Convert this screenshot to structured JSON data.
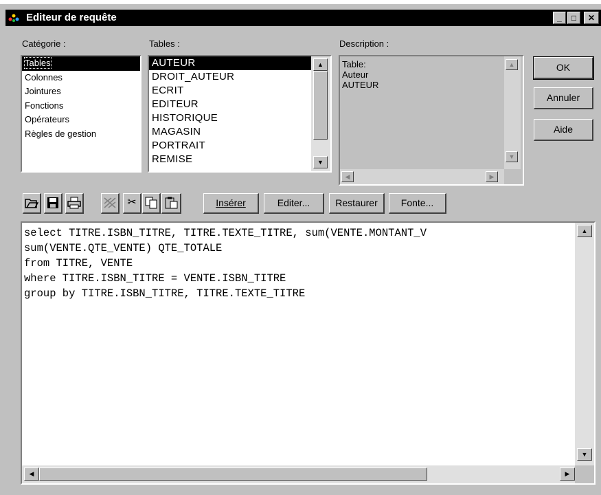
{
  "window": {
    "title": "Editeur de requête"
  },
  "labels": {
    "categorie": "Catégorie :",
    "tables": "Tables :",
    "description": "Description :"
  },
  "categories": [
    "Tables",
    "Colonnes",
    "Jointures",
    "Fonctions",
    "Opérateurs",
    "Règles de gestion"
  ],
  "tables": [
    "AUTEUR",
    "DROIT_AUTEUR",
    "ECRIT",
    "EDITEUR",
    "HISTORIQUE",
    "MAGASIN",
    "PORTRAIT",
    "REMISE"
  ],
  "description_lines": [
    "Table:",
    "Auteur",
    "AUTEUR"
  ],
  "buttons": {
    "ok": "OK",
    "annuler": "Annuler",
    "aide": "Aide"
  },
  "toolbar": {
    "inserer": "Insérer",
    "editer": "Editer...",
    "restaurer": "Restaurer",
    "fonte": "Fonte...",
    "icons": [
      "open-icon",
      "save-icon",
      "print-icon",
      "clear-icon",
      "cut-icon",
      "copy-icon",
      "paste-icon"
    ]
  },
  "query_lines": [
    "select TITRE.ISBN_TITRE, TITRE.TEXTE_TITRE, sum(VENTE.MONTANT_V",
    "sum(VENTE.QTE_VENTE) QTE_TOTALE",
    "from TITRE, VENTE",
    "where TITRE.ISBN_TITRE = VENTE.ISBN_TITRE",
    "group by TITRE.ISBN_TITRE, TITRE.TEXTE_TITRE"
  ],
  "selected_category": "Tables",
  "selected_table": "AUTEUR",
  "colors": {
    "titlebar": "#000000",
    "face": "#c0c0c0",
    "selection": "#000000"
  }
}
